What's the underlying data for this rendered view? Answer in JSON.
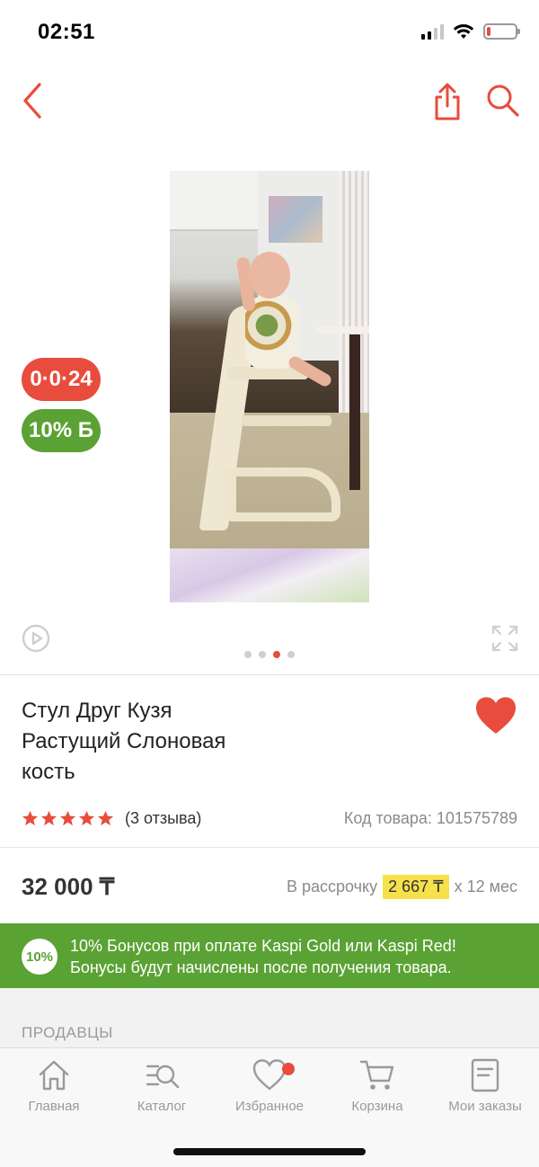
{
  "status_bar": {
    "time": "02:51"
  },
  "nav": {
    "back_icon": "chevron-left-icon",
    "share_icon": "share-icon",
    "search_icon": "search-icon"
  },
  "badges": {
    "installment": "0·0·24",
    "bonus": "10% Б"
  },
  "carousel": {
    "total": 4,
    "active_index": 2
  },
  "product": {
    "title_line1": "Стул Друг Кузя",
    "title_line2": "Растущий Слоновая",
    "title_line3": "кость",
    "rating": 5,
    "reviews": "(3 отзыва)",
    "code": "Код товара: 101575789",
    "price": "32 000 ₸"
  },
  "installment": {
    "prefix": "В рассрочку",
    "amount": "2 667 ₸",
    "suffix": "x 12 мес"
  },
  "bonus_banner": {
    "badge": "10%",
    "line1": "10% Бонусов при оплате Kaspi Gold или Kaspi Red!",
    "line2": "Бонусы будут начислены после получения товара."
  },
  "sellers": {
    "title": "ПРОДАВЦЫ"
  },
  "tabs": [
    {
      "label": "Главная",
      "icon": "home-icon"
    },
    {
      "label": "Каталог",
      "icon": "catalog-icon"
    },
    {
      "label": "Избранное",
      "icon": "heart-outline-icon"
    },
    {
      "label": "Корзина",
      "icon": "cart-icon"
    },
    {
      "label": "Мои заказы",
      "icon": "orders-icon"
    }
  ],
  "colors": {
    "accent": "#e84c3d",
    "bonus_green": "#5ba234",
    "installment_yellow": "#f6e14b"
  }
}
